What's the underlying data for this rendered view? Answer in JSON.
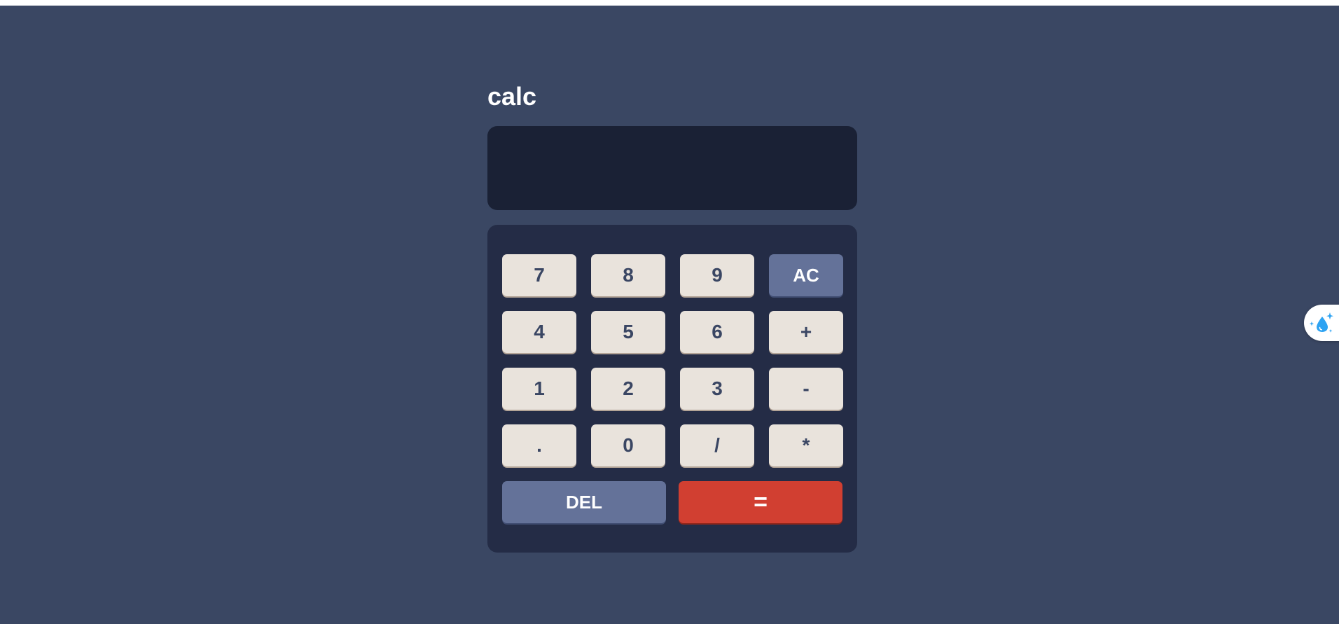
{
  "app": {
    "title": "calc",
    "display_value": ""
  },
  "keypad": {
    "rows": [
      [
        "7",
        "8",
        "9",
        "AC"
      ],
      [
        "4",
        "5",
        "6",
        "+"
      ],
      [
        "1",
        "2",
        "3",
        "-"
      ],
      [
        ".",
        "0",
        "/",
        "*"
      ]
    ],
    "del_label": "DEL",
    "equals_label": "="
  },
  "extension": {
    "icon": "water-drop-sparkle-icon"
  },
  "colors": {
    "background": "#3a4763",
    "display": "#1a2135",
    "keypad": "#242c46",
    "key": "#e9e3dc",
    "key_text": "#3a4663",
    "key_accent": "#647299",
    "key_equals": "#d13f31",
    "extension_icon": "#2ea3f2"
  }
}
